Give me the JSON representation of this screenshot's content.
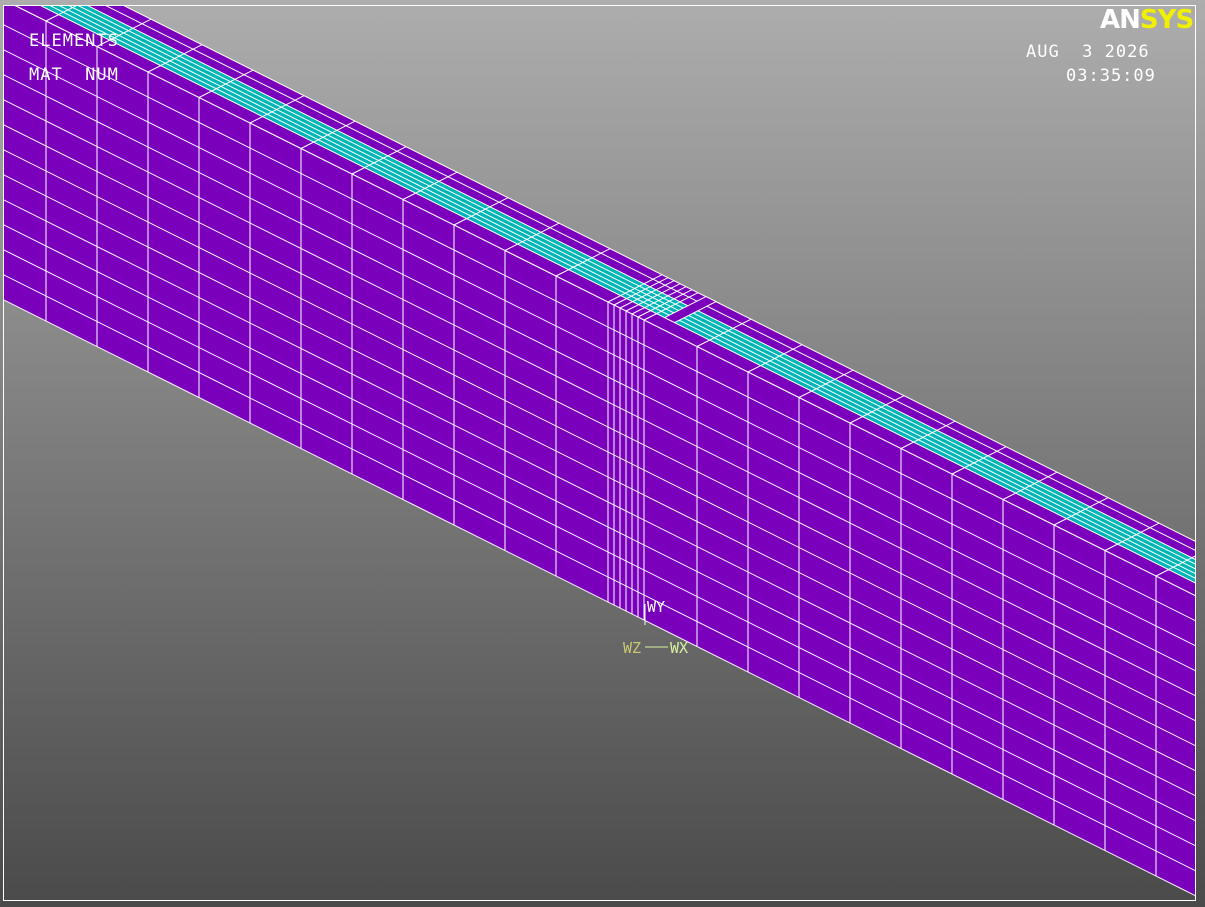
{
  "program": {
    "logo_part1": "AN",
    "logo_part2": "SYS",
    "logo_color_primary": "#ffffff",
    "logo_color_secondary": "#f0f000"
  },
  "plot_info": {
    "line1": "ELEMENTS",
    "line2": "MAT  NUM"
  },
  "timestamp": {
    "date": "AUG  3 2026",
    "time": "03:35:09"
  },
  "working_plane": {
    "wy": "WY",
    "wx": "WX",
    "wz": "WZ"
  },
  "colors": {
    "background_top": "#adadad",
    "background_bottom": "#4a4a4a",
    "material_1": "#7a00bb",
    "material_2": "#00b5b5",
    "mesh_lines": "#ffffff",
    "border": "#ffffff"
  }
}
